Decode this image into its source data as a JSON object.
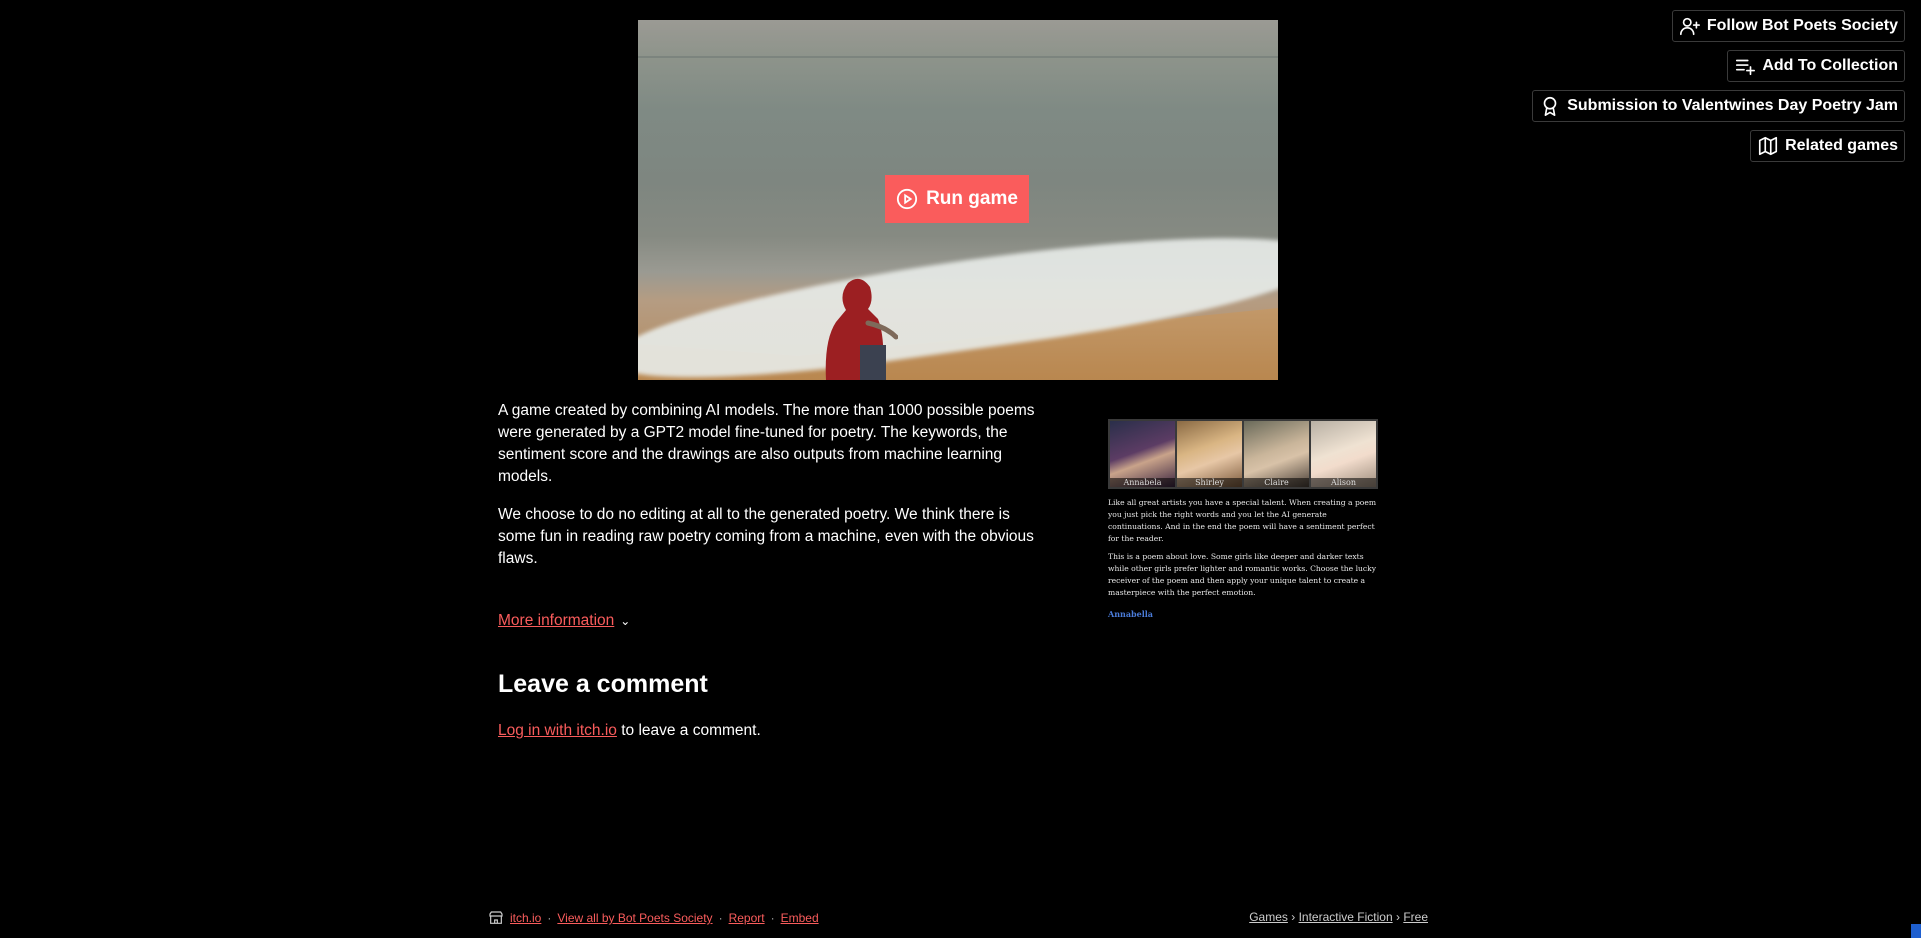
{
  "actions": {
    "follow": "Follow Bot Poets Society",
    "collection": "Add To Collection",
    "submission": "Submission to Valentwines Day Poetry Jam",
    "related": "Related games"
  },
  "embed": {
    "run_label": "Run game"
  },
  "description": {
    "p1": "A game created by combining AI models. The more than 1000 possible  poems were generated by a GPT2 model fine-tuned for poetry. The keywords, the sentiment score and the drawings are also outputs from machine learning models.",
    "p2": "We choose to do no editing at all to the generated poetry. We think there is some fun in reading raw poetry coming from a machine, even with the obvious flaws.",
    "more": "More information"
  },
  "comments": {
    "title": "Leave a comment",
    "login_link": "Log in with itch.io",
    "login_suffix": " to leave a comment."
  },
  "side": {
    "portraits": [
      {
        "name": "Annabela"
      },
      {
        "name": "Shirley"
      },
      {
        "name": "Claire"
      },
      {
        "name": "Alison"
      }
    ],
    "text1": "Like all great artists you have a special talent. When creating a poem you just pick the right words and you let the AI generate continuations. And in the end the poem will have a sentiment perfect for the reader.",
    "text2": "This is a poem about love. Some girls like deeper and darker texts while other girls prefer lighter and romantic works. Choose the lucky receiver of the poem and then apply your unique talent to create a masterpiece with the perfect emotion.",
    "link": "Annabella"
  },
  "footer": {
    "itch": "itch.io",
    "view_all": "View all by Bot Poets Society",
    "report": "Report",
    "embed": "Embed",
    "sep": "·"
  },
  "crumbs": {
    "games": "Games",
    "genre": "Interactive Fiction",
    "price": "Free",
    "sep": "›"
  },
  "colors": {
    "accent": "#fa5c5c",
    "background": "#000000",
    "link_blue": "#4a7bd8"
  }
}
